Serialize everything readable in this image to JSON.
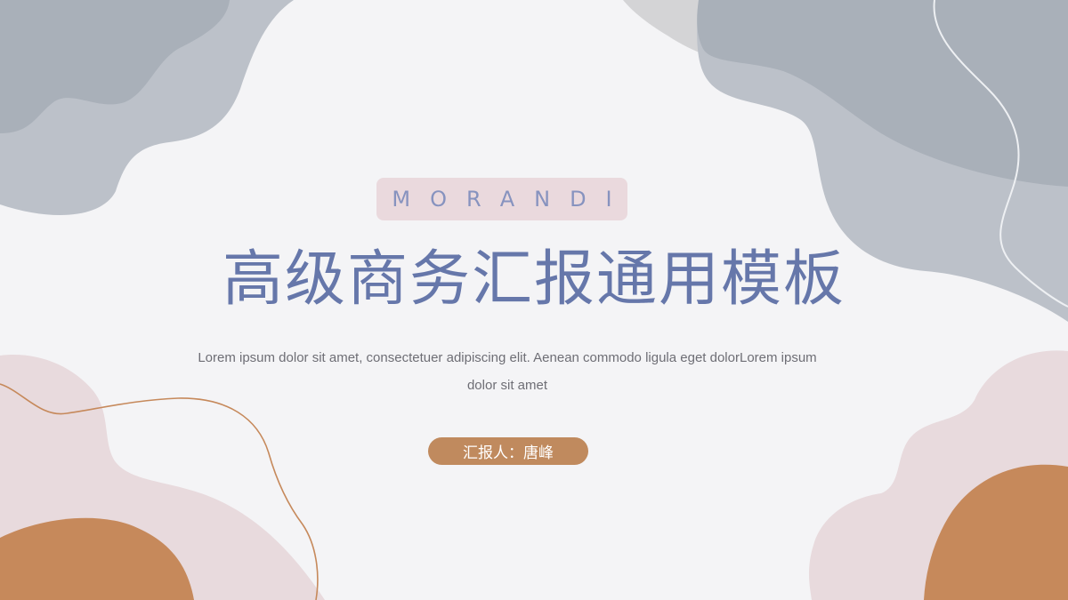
{
  "slide": {
    "badge_text": "MORANDI",
    "title": "高级商务汇报通用模板",
    "subtitle": "Lorem ipsum dolor sit amet, consectetuer adipiscing elit. Aenean commodo ligula eget dolorLorem ipsum dolor sit amet",
    "reporter_label": "汇报人：唐峰"
  },
  "colors": {
    "background": "#f4f4f6",
    "gray_blob": "#a9b0b9",
    "light_gray_blob": "#bcc1c9",
    "pale_gray_blob": "#d4d4d6",
    "pink_blob": "#e8dadd",
    "orange_blob": "#c6895b",
    "title": "#6677aa",
    "badge_bg": "#ead9dd",
    "badge_text": "#8793bf"
  }
}
